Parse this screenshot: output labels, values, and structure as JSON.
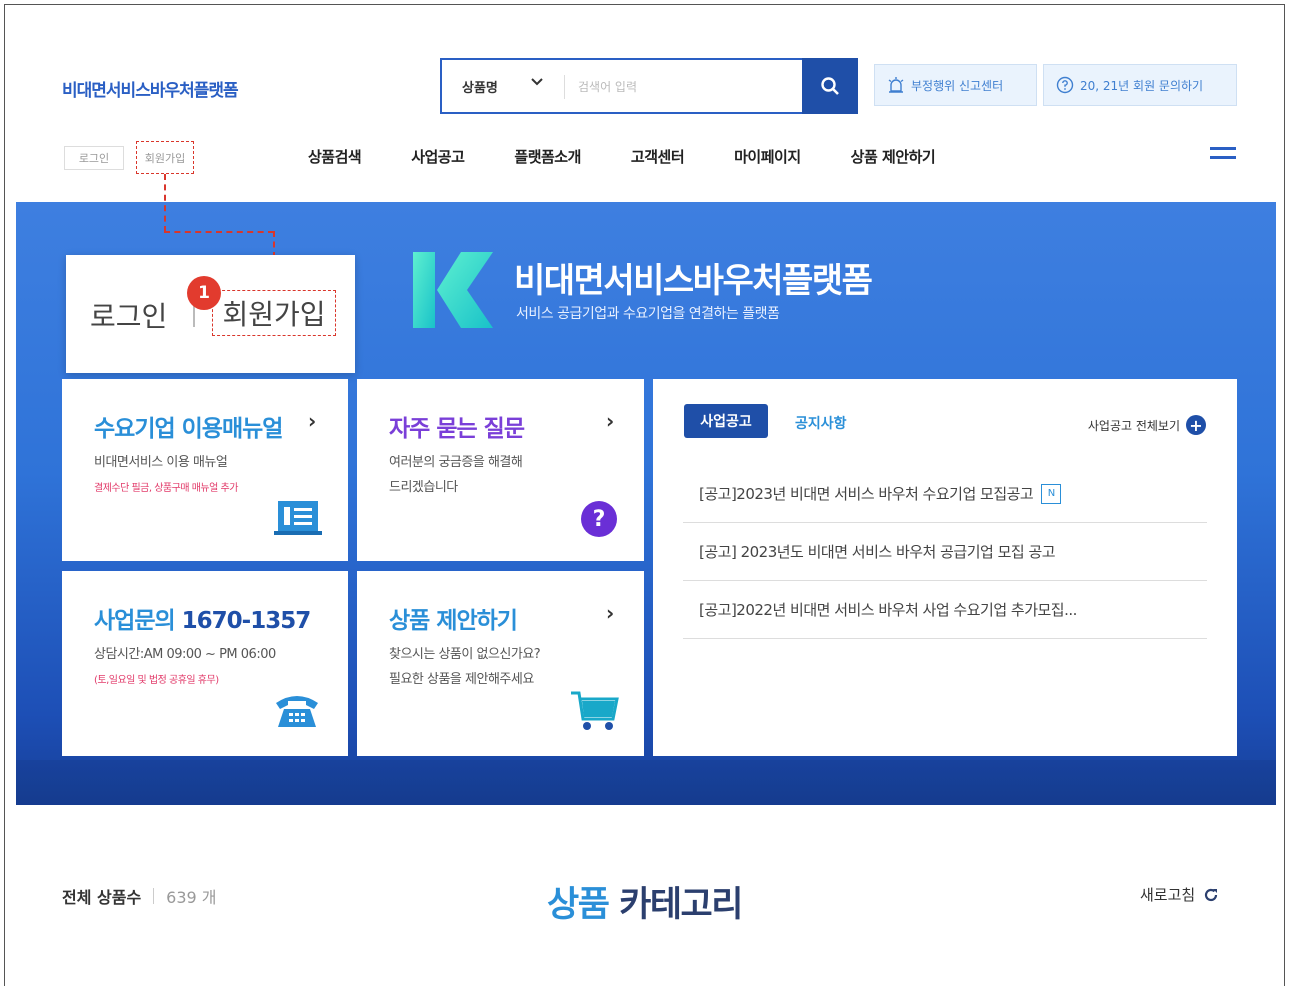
{
  "header": {
    "logo": "비대면서비스바우처플랫폼",
    "search": {
      "category": "상품명",
      "placeholder": "검색어 입력"
    },
    "buttons": {
      "report": "부정행위 신고센터",
      "inquiry": "20, 21년 회원 문의하기"
    },
    "login": "로그인",
    "join": "회원가입"
  },
  "nav": {
    "items": [
      "상품검색",
      "사업공고",
      "플랫폼소개",
      "고객센터",
      "마이페이지",
      "상품 제안하기"
    ]
  },
  "banner": {
    "title": "비대면서비스바우처플랫폼",
    "subtitle": "서비스 공급기업과 수요기업을 연결하는 플랫폼",
    "login": "로그인",
    "join": "회원가입",
    "step": "1"
  },
  "cards": {
    "manual": {
      "title": "수요기업 이용매뉴얼",
      "desc": "비대면서비스 이용 매뉴얼",
      "note": "결제수단 필금, 상품구매 매뉴얼 추가"
    },
    "faq": {
      "title": "자주 묻는 질문",
      "desc1": "여러분의 궁금증을 해결해",
      "desc2": "드리겠습니다"
    },
    "contact": {
      "title_label": "사업문의",
      "phone": "1670-1357",
      "hours": "상담시간:AM 09:00 ~ PM 06:00",
      "note": "(토,일요일 및 법정 공휴일 휴무)"
    },
    "suggest": {
      "title": "상품 제안하기",
      "desc1": "찾으시는 상품이 없으신가요?",
      "desc2": "필요한 상품을 제안해주세요"
    }
  },
  "notices": {
    "tab_active": "사업공고",
    "tab_inactive": "공지사항",
    "more": "사업공고 전체보기",
    "items": [
      "[공고]2023년 비대면 서비스 바우처 수요기업 모집공고",
      "[공고] 2023년도 비대면 서비스 바우처 공급기업 모집 공고",
      "[공고]2022년 비대면 서비스 바우처 사업 수요기업 추가모집..."
    ],
    "new_badge": "N"
  },
  "category": {
    "total_label": "전체 상품수",
    "total_count": "639 개",
    "title_part1": "상품",
    "title_part2": "카테고리",
    "refresh": "새로고침"
  },
  "colors": {
    "brand": "#2a5fc4",
    "navy": "#1f4fa8",
    "highlight": "#d9362b"
  }
}
